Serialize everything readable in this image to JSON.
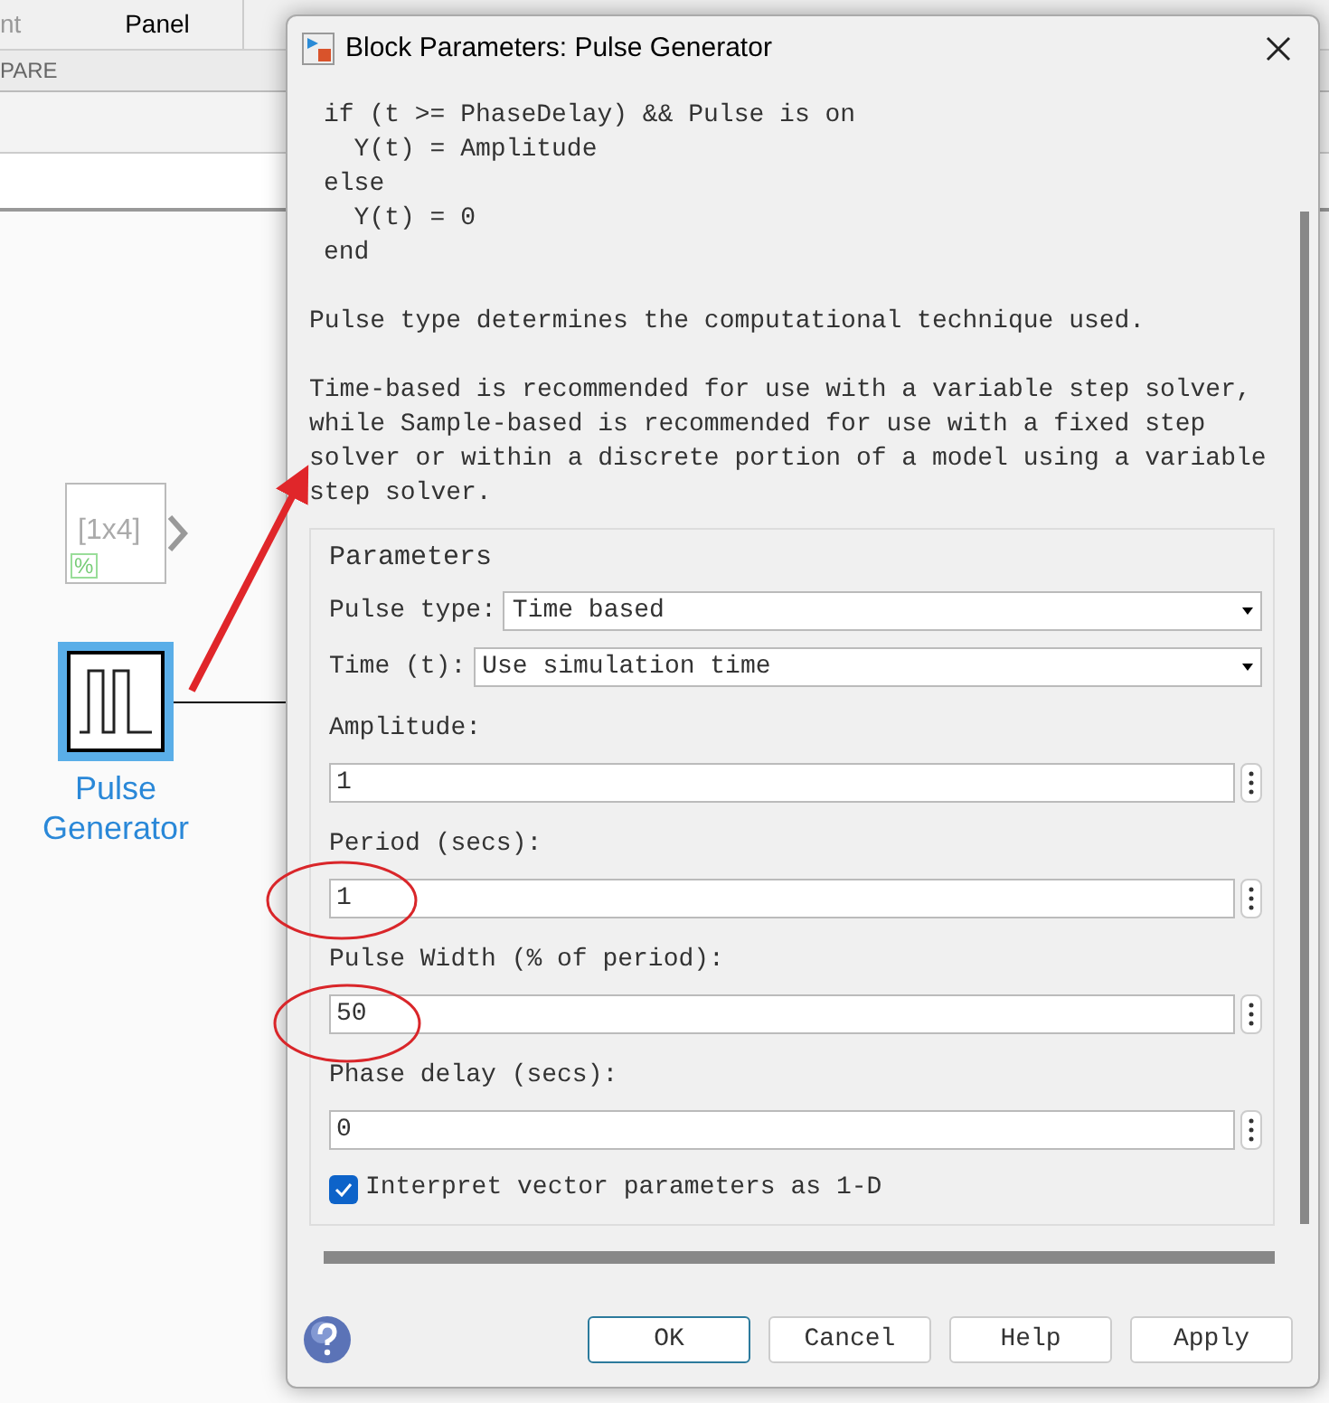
{
  "app": {
    "tabs": [
      {
        "label": "nt",
        "selected": false
      },
      {
        "label": "Panel",
        "selected": false
      }
    ],
    "section_label": "PARE"
  },
  "canvas": {
    "blocks": [
      {
        "kind": "display",
        "label": "[1x4]",
        "badge": "%",
        "selected": false
      },
      {
        "kind": "pulse",
        "name": "Pulse Generator",
        "selected": true
      }
    ]
  },
  "dialog": {
    "title": "Block Parameters: Pulse Generator",
    "code_lines": [
      "if (t >= PhaseDelay) && Pulse is on",
      "  Y(t) = Amplitude",
      "else",
      "  Y(t) = 0",
      "end"
    ],
    "paragraphs": [
      "Pulse type determines the computational technique used.",
      "Time-based is recommended for use with a variable step solver, while Sample-based is recommended for use with a fixed step solver or within a discrete portion of a model using a variable step solver."
    ],
    "group_title": "Parameters",
    "params": [
      {
        "kind": "dropdown",
        "label": "Pulse type:",
        "value": "Time based"
      },
      {
        "kind": "dropdown",
        "label": "Time (t):",
        "value": "Use simulation time"
      },
      {
        "kind": "field",
        "label": "Amplitude:",
        "value": "1"
      },
      {
        "kind": "field",
        "label": "Period (secs):",
        "value": "1"
      },
      {
        "kind": "field",
        "label": "Pulse Width (% of period):",
        "value": "50"
      },
      {
        "kind": "field",
        "label": "Phase delay (secs):",
        "value": "0"
      }
    ],
    "checkbox": {
      "label": "Interpret vector parameters as 1-D",
      "checked": true
    },
    "buttons": [
      {
        "label": "OK",
        "selected": true
      },
      {
        "label": "Cancel",
        "selected": false
      },
      {
        "label": "Help",
        "selected": false
      },
      {
        "label": "Apply",
        "selected": false
      }
    ]
  }
}
